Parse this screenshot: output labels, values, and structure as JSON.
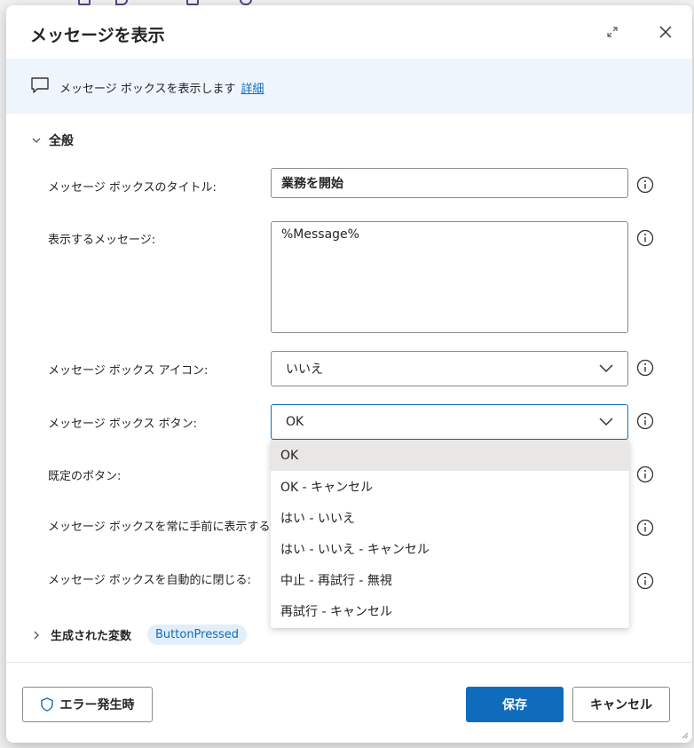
{
  "dialog": {
    "title": "メッセージを表示"
  },
  "banner": {
    "text": "メッセージ ボックスを表示します",
    "link": "詳細"
  },
  "section": {
    "label": "全般"
  },
  "fields": {
    "title_label": "メッセージ ボックスのタイトル:",
    "title_value": "業務を開始",
    "message_label": "表示するメッセージ:",
    "message_value": "%Message%",
    "icon_label": "メッセージ ボックス アイコン:",
    "icon_value": "いいえ",
    "buttons_label": "メッセージ ボックス ボタン:",
    "buttons_value": "OK",
    "default_label": "既定のボタン:",
    "topmost_label": "メッセージ ボックスを常に手前に表示する:",
    "autoclose_label": "メッセージ ボックスを自動的に閉じる:"
  },
  "dropdown": {
    "options": [
      "OK",
      "OK - キャンセル",
      "はい - いいえ",
      "はい - いいえ - キャンセル",
      "中止 - 再試行 - 無視",
      "再試行 - キャンセル"
    ],
    "selected": "OK"
  },
  "generated": {
    "label": "生成された変数",
    "variable": "ButtonPressed"
  },
  "footer": {
    "error_button": "エラー発生時",
    "save_button": "保存",
    "cancel_button": "キャンセル"
  },
  "colors": {
    "accent": "#0f6cbd",
    "banner_bg": "#eff5fc",
    "selected_option_bg": "#e9e7e5",
    "chip_bg": "#e2effa"
  }
}
